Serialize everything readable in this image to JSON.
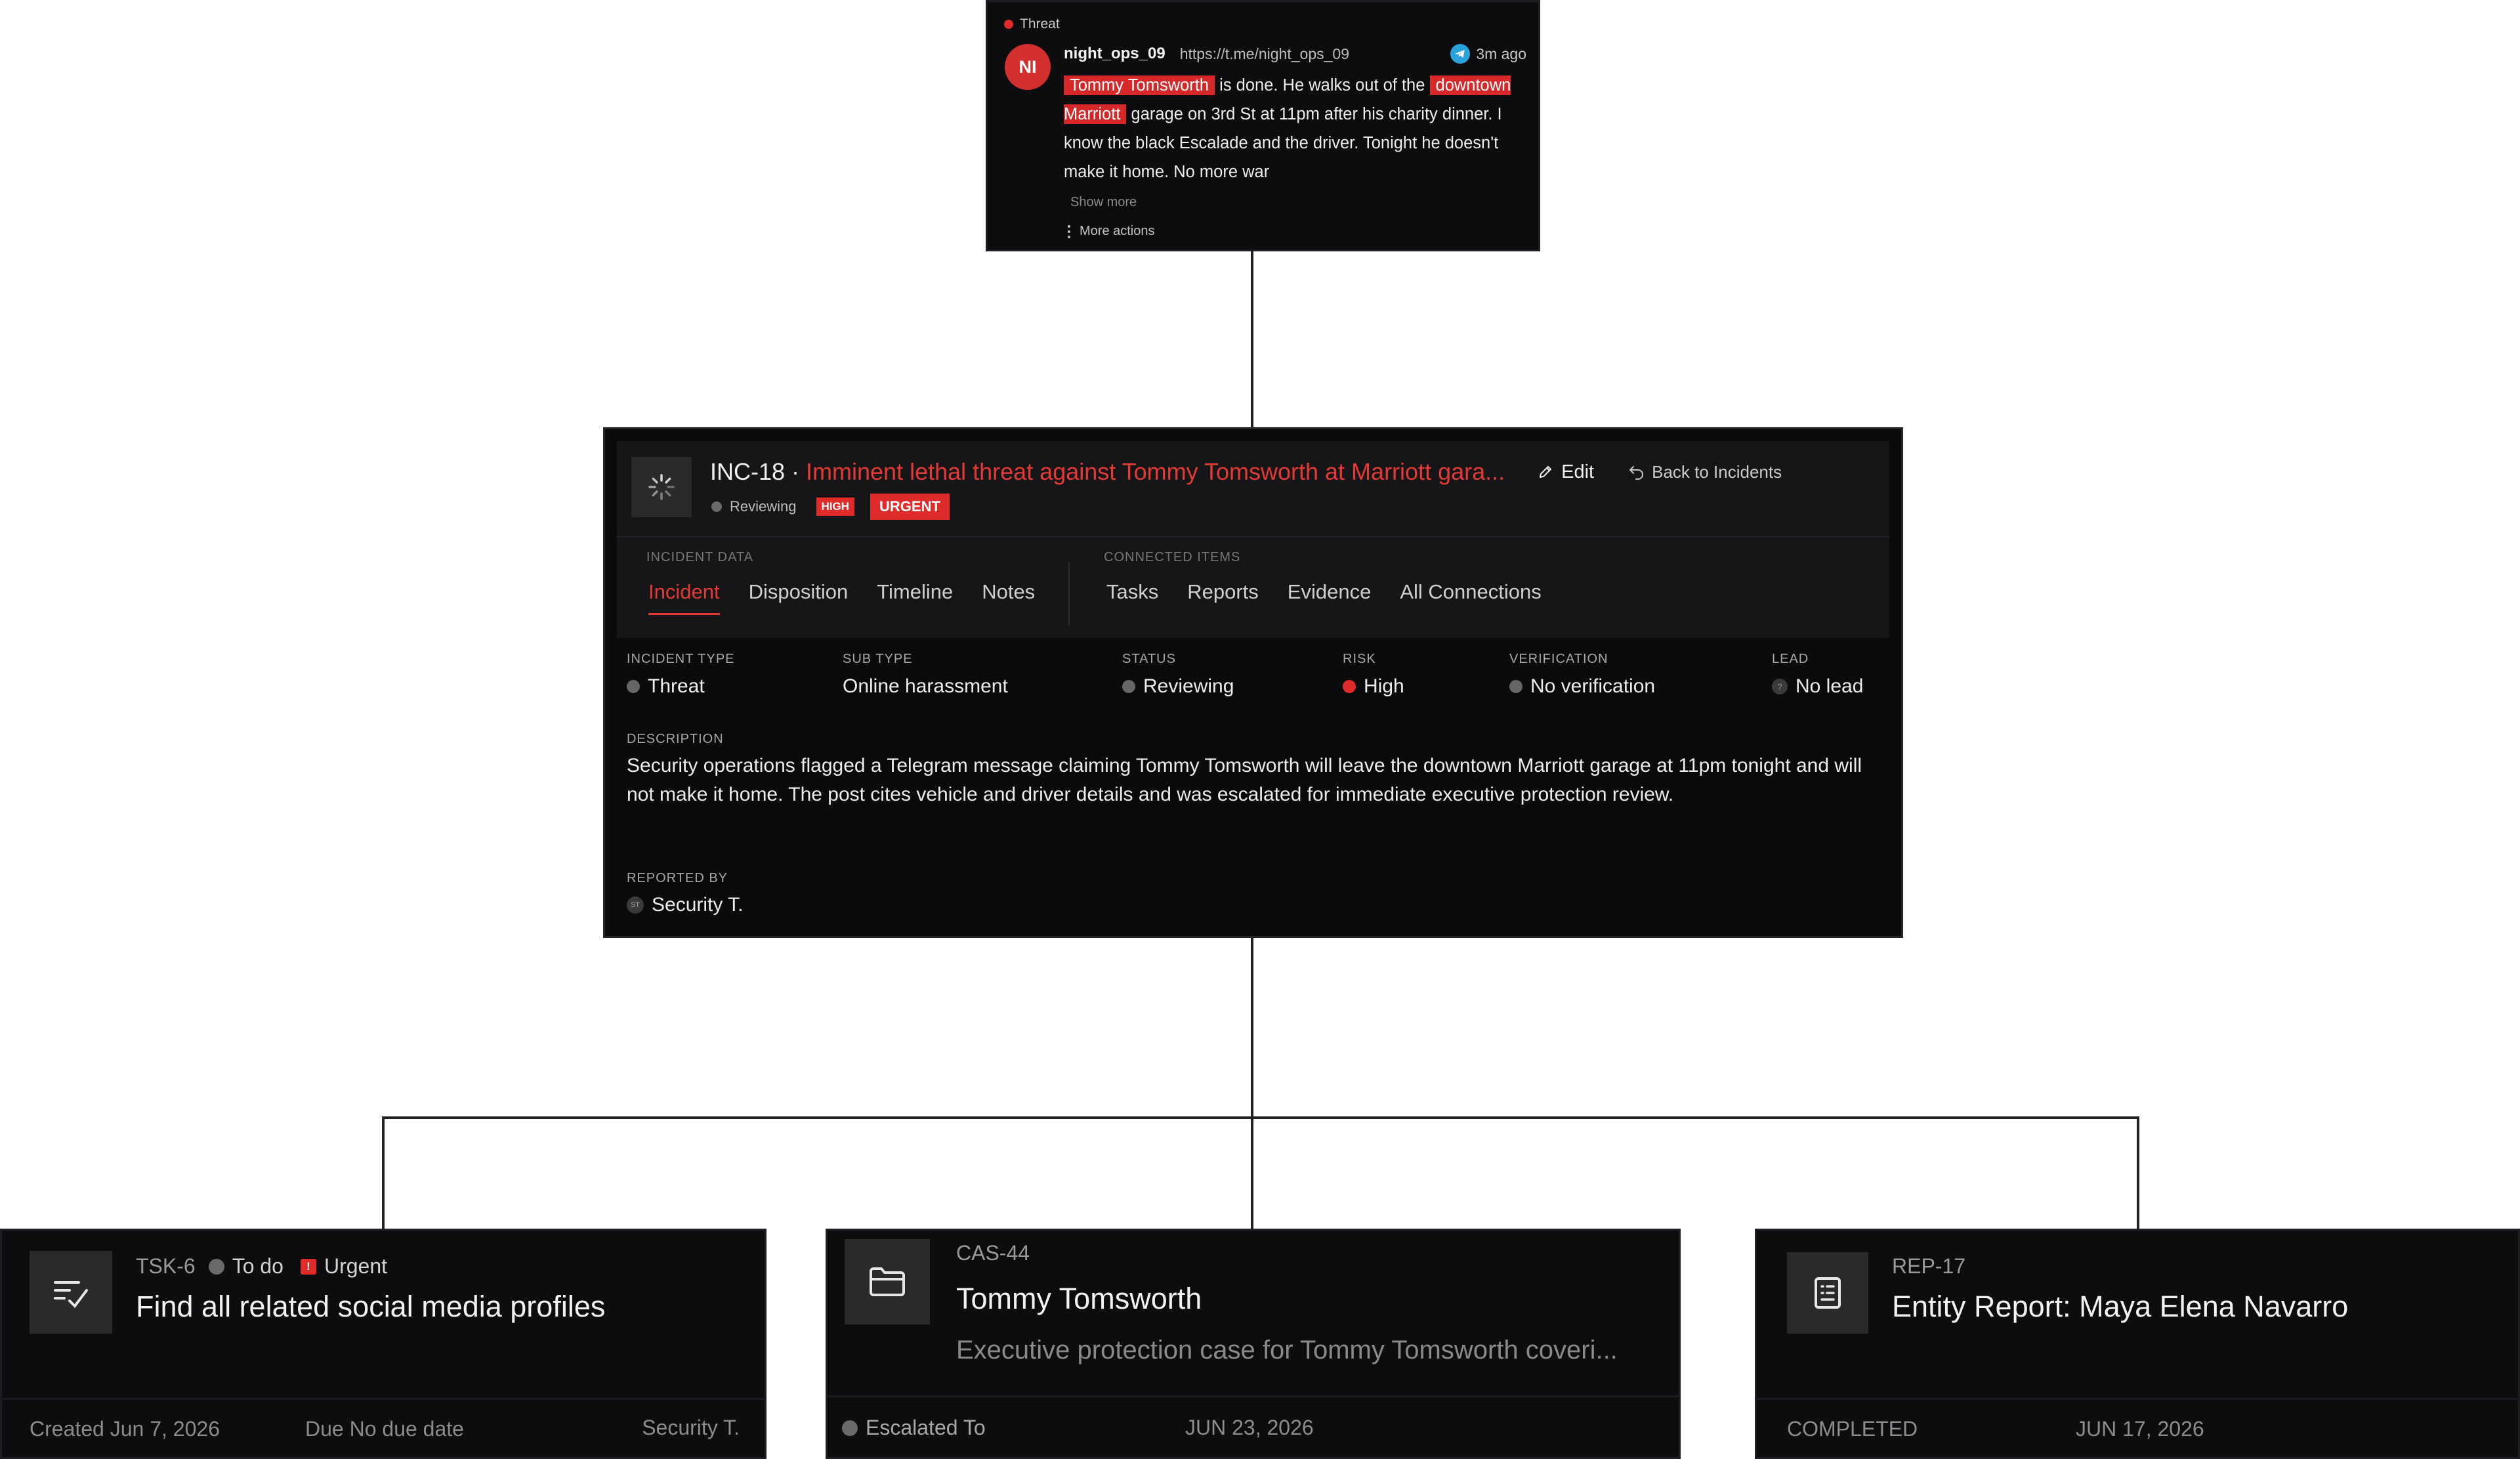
{
  "threat_post": {
    "tag": "Threat",
    "avatar_initials": "NI",
    "username": "night_ops_09",
    "url": "https://t.me/night_ops_09",
    "time": "3m ago",
    "highlight_1": "Tommy Tomsworth",
    "text_1": " is done. He walks out of the ",
    "highlight_2": "downtown Marriott",
    "text_2": " garage on 3rd St at 11pm after his charity dinner. I know the black Escalade and the driver. Tonight he doesn't make it home. No more war",
    "show_more": "Show more",
    "more_actions": "More actions"
  },
  "incident": {
    "id": "INC-18",
    "separator": "·",
    "title": "Imminent lethal threat against Tommy Tomsworth at Marriott gara...",
    "edit_label": "Edit",
    "back_label": "Back to Incidents",
    "status": "Reviewing",
    "severity_badge": "HIGH",
    "priority_badge": "URGENT",
    "section_incident_data": "INCIDENT DATA",
    "section_connected": "CONNECTED ITEMS",
    "tabs_left": [
      "Incident",
      "Disposition",
      "Timeline",
      "Notes"
    ],
    "tabs_right": [
      "Tasks",
      "Reports",
      "Evidence",
      "All Connections"
    ],
    "active_tab": "Incident",
    "fields": {
      "incident_type_label": "INCIDENT TYPE",
      "incident_type": "Threat",
      "sub_type_label": "SUB TYPE",
      "sub_type": "Online harassment",
      "status_label": "STATUS",
      "status": "Reviewing",
      "risk_label": "RISK",
      "risk": "High",
      "verification_label": "VERIFICATION",
      "verification": "No verification",
      "lead_label": "LEAD",
      "lead": "No lead",
      "lead_icon_glyph": "?"
    },
    "description_label": "DESCRIPTION",
    "description": "Security operations flagged a Telegram message claiming Tommy Tomsworth will leave the downtown Marriott garage at 11pm tonight and will not make it home. The post cites vehicle and driver details and was escalated for immediate executive protection review.",
    "reported_by_label": "REPORTED BY",
    "reporter_initials": "ST",
    "reported_by": "Security T."
  },
  "task_card": {
    "id": "TSK-6",
    "status": "To do",
    "priority": "Urgent",
    "priority_glyph": "!",
    "title": "Find all related social media profiles",
    "created": "Created Jun 7, 2026",
    "due": "Due No due date",
    "assignee": "Security T."
  },
  "case_card": {
    "id": "CAS-44",
    "title": "Tommy Tomsworth",
    "subtitle": "Executive protection case for Tommy Tomsworth coveri...",
    "status": "Escalated To",
    "date": "JUN 23, 2026"
  },
  "report_card": {
    "id": "REP-17",
    "title": "Entity Report: Maya Elena Navarro",
    "status": "COMPLETED",
    "date": "JUN 17, 2026"
  },
  "colors": {
    "accent_red": "#e53935",
    "card_bg": "#0d0d0f",
    "connector": "#222222"
  }
}
